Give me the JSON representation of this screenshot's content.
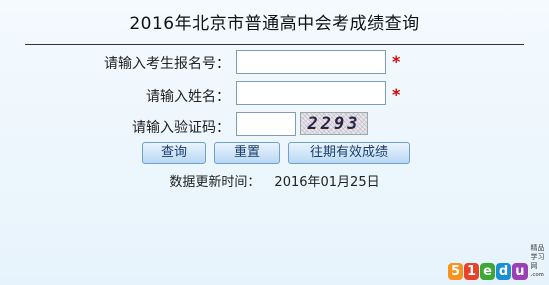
{
  "title": "2016年北京市普通高中会考成绩查询",
  "form": {
    "exam_number_label": "请输入考生报名号：",
    "name_label": "请输入姓名：",
    "captcha_label": "请输入验证码：",
    "required_mark": "*",
    "captcha_text": "2293"
  },
  "buttons": {
    "query": "查询",
    "reset": "重置",
    "past_results": "往期有效成绩"
  },
  "update": {
    "label": "数据更新时间：",
    "date": "2016年01月25日"
  },
  "logo": {
    "chars": [
      "5",
      "1",
      "e",
      "d",
      "u"
    ],
    "colors": [
      "#f7931e",
      "#e8412c",
      "#3aa935",
      "#1b8fd6",
      "#9b3fb5"
    ],
    "text": "精品学习网",
    "domain": ".com"
  }
}
